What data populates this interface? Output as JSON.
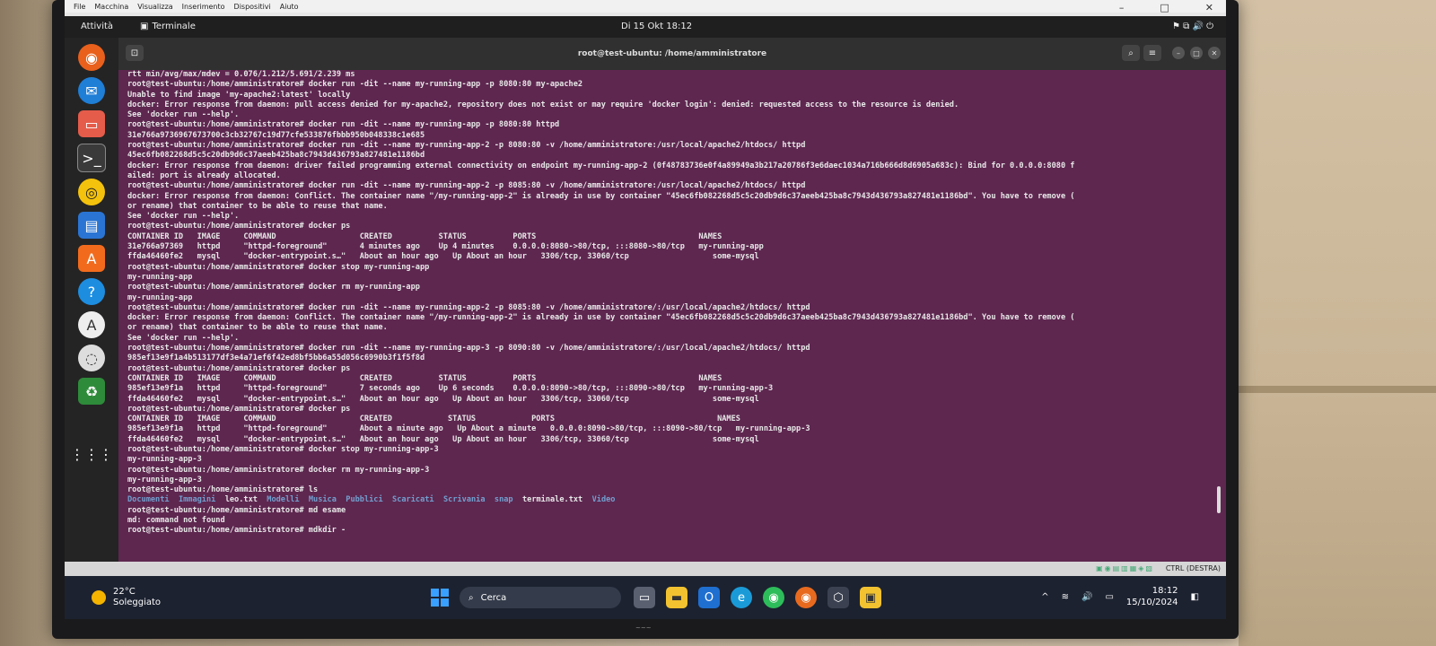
{
  "vm_menu": [
    "File",
    "Macchina",
    "Visualizza",
    "Inserimento",
    "Dispositivi",
    "Aiuto"
  ],
  "ubuntu_topbar": {
    "activities": "Attività",
    "app_name": "Terminale",
    "clock": "Di 15 Okt 18:12"
  },
  "terminal": {
    "title": "root@test-ubuntu: /home/amministratore",
    "lines": [
      "rtt min/avg/max/mdev = 0.076/1.212/5.691/2.239 ms",
      "root@test-ubuntu:/home/amministratore# docker run -dit --name my-running-app -p 8080:80 my-apache2",
      "Unable to find image 'my-apache2:latest' locally",
      "docker: Error response from daemon: pull access denied for my-apache2, repository does not exist or may require 'docker login': denied: requested access to the resource is denied.",
      "See 'docker run --help'.",
      "root@test-ubuntu:/home/amministratore# docker run -dit --name my-running-app -p 8080:80 httpd",
      "31e766a9736967673700c3cb32767c19d77cfe533876fbbb950b048338c1e685",
      "root@test-ubuntu:/home/amministratore# docker run -dit --name my-running-app-2 -p 8080:80 -v /home/amministratore:/usr/local/apache2/htdocs/ httpd",
      "45ec6fb082268d5c5c20db9d6c37aeeb425ba8c7943d436793a827481e1186bd",
      "docker: Error response from daemon: driver failed programming external connectivity on endpoint my-running-app-2 (0f48783736e0f4a89949a3b217a20786f3e6daec1034a716b666d8d6905a683c): Bind for 0.0.0.0:8080 f",
      "ailed: port is already allocated.",
      "root@test-ubuntu:/home/amministratore# docker run -dit --name my-running-app-2 -p 8085:80 -v /home/amministratore:/usr/local/apache2/htdocs/ httpd",
      "docker: Error response from daemon: Conflict. The container name \"/my-running-app-2\" is already in use by container \"45ec6fb082268d5c5c20db9d6c37aeeb425ba8c7943d436793a827481e1186bd\". You have to remove (",
      "or rename) that container to be able to reuse that name.",
      "See 'docker run --help'.",
      "root@test-ubuntu:/home/amministratore# docker ps",
      "CONTAINER ID   IMAGE     COMMAND                  CREATED          STATUS          PORTS                                   NAMES",
      "31e766a97369   httpd     \"httpd-foreground\"       4 minutes ago    Up 4 minutes    0.0.0.0:8080->80/tcp, :::8080->80/tcp   my-running-app",
      "ffda46460fe2   mysql     \"docker-entrypoint.s…\"   About an hour ago   Up About an hour   3306/tcp, 33060/tcp                  some-mysql",
      "root@test-ubuntu:/home/amministratore# docker stop my-running-app",
      "my-running-app",
      "root@test-ubuntu:/home/amministratore# docker rm my-running-app",
      "my-running-app",
      "root@test-ubuntu:/home/amministratore# docker run -dit --name my-running-app-2 -p 8085:80 -v /home/amministratore/:/usr/local/apache2/htdocs/ httpd",
      "docker: Error response from daemon: Conflict. The container name \"/my-running-app-2\" is already in use by container \"45ec6fb082268d5c5c20db9d6c37aeeb425ba8c7943d436793a827481e1186bd\". You have to remove (",
      "or rename) that container to be able to reuse that name.",
      "See 'docker run --help'.",
      "root@test-ubuntu:/home/amministratore# docker run -dit --name my-running-app-3 -p 8090:80 -v /home/amministratore/:/usr/local/apache2/htdocs/ httpd",
      "985ef13e9f1a4b513177df3e4a71ef6f42ed8bf5bb6a55d056c6990b3f1f5f8d",
      "root@test-ubuntu:/home/amministratore# docker ps",
      "CONTAINER ID   IMAGE     COMMAND                  CREATED          STATUS          PORTS                                   NAMES",
      "985ef13e9f1a   httpd     \"httpd-foreground\"       7 seconds ago    Up 6 seconds    0.0.0.0:8090->80/tcp, :::8090->80/tcp   my-running-app-3",
      "ffda46460fe2   mysql     \"docker-entrypoint.s…\"   About an hour ago   Up About an hour   3306/tcp, 33060/tcp                  some-mysql",
      "root@test-ubuntu:/home/amministratore# docker ps",
      "CONTAINER ID   IMAGE     COMMAND                  CREATED            STATUS            PORTS                                   NAMES",
      "985ef13e9f1a   httpd     \"httpd-foreground\"       About a minute ago   Up About a minute   0.0.0.0:8090->80/tcp, :::8090->80/tcp   my-running-app-3",
      "ffda46460fe2   mysql     \"docker-entrypoint.s…\"   About an hour ago   Up About an hour   3306/tcp, 33060/tcp                  some-mysql",
      "root@test-ubuntu:/home/amministratore# docker stop my-running-app-3",
      "my-running-app-3",
      "root@test-ubuntu:/home/amministratore# docker rm my-running-app-3",
      "my-running-app-3",
      "root@test-ubuntu:/home/amministratore# ls"
    ],
    "ls_output": [
      "Documenti",
      "Immagini",
      "leo.txt",
      "Modelli",
      "Musica",
      "Pubblici",
      "Scaricati",
      "Scrivania",
      "snap",
      "terminale.txt",
      "Video"
    ],
    "ls_files": [
      "leo.txt",
      "terminale.txt"
    ],
    "tail_lines": [
      "root@test-ubuntu:/home/amministratore# md esame",
      "md: command not found",
      "root@test-ubuntu:/home/amministratore# mdkdir -"
    ]
  },
  "vm_status": {
    "ctrl_label": "CTRL (DESTRA)"
  },
  "taskbar": {
    "temperature": "22°C",
    "weather": "Soleggiato",
    "search_placeholder": "Cerca",
    "time": "18:12",
    "date": "15/10/2024"
  },
  "colors": {
    "terminal_bg": "#5e2750",
    "ls_dir": "#729fcf"
  }
}
